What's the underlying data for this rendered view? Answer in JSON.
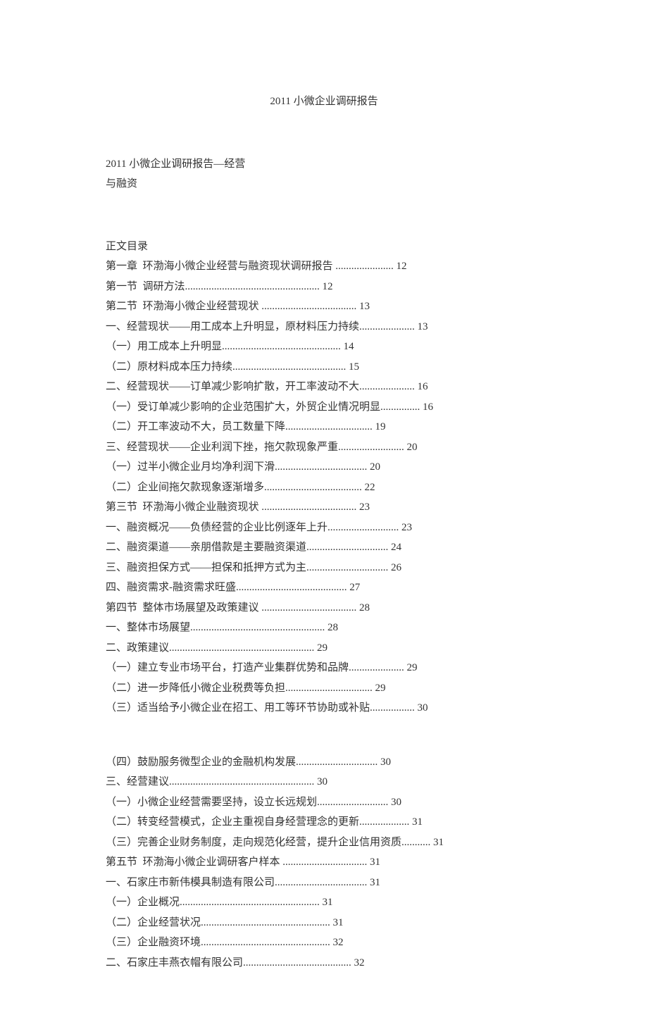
{
  "title": "2011 小微企业调研报告",
  "subtitle_line1": "2011 小微企业调研报告—经营",
  "subtitle_line2": "与融资",
  "toc_heading": "正文目录",
  "toc": [
    {
      "text": "第一章  环渤海小微企业经营与融资现状调研报告 ",
      "page": "12"
    },
    {
      "text": "第一节  调研方法",
      "page": "12"
    },
    {
      "text": "第二节  环渤海小微企业经营现状 ",
      "page": "13"
    },
    {
      "text": "一、经营现状——用工成本上升明显，原材料压力持续",
      "page": "13"
    },
    {
      "text": "（一）用工成本上升明显",
      "page": "14"
    },
    {
      "text": "（二）原材料成本压力持续",
      "page": "15"
    },
    {
      "text": "二、经营现状——订单减少影响扩散，开工率波动不大",
      "page": "16"
    },
    {
      "text": "（一）受订单减少影响的企业范围扩大，外贸企业情况明显",
      "page": "16"
    },
    {
      "text": "（二）开工率波动不大，员工数量下降",
      "page": "19"
    },
    {
      "text": "三、经营现状——企业利润下挫，拖欠款现象严重",
      "page": "20"
    },
    {
      "text": "（一）过半小微企业月均净利润下滑",
      "page": "20"
    },
    {
      "text": "（二）企业间拖欠款现象逐渐增多",
      "page": "22"
    },
    {
      "text": "第三节  环渤海小微企业融资现状 ",
      "page": "23"
    },
    {
      "text": "一、融资概况——负债经营的企业比例逐年上升",
      "page": "23"
    },
    {
      "text": "二、融资渠道——亲朋借款是主要融资渠道",
      "page": "24"
    },
    {
      "text": "三、融资担保方式——担保和抵押方式为主",
      "page": "26"
    },
    {
      "text": "四、融资需求-融资需求旺盛",
      "page": "27"
    },
    {
      "text": "第四节  整体市场展望及政策建议 ",
      "page": "28"
    },
    {
      "text": "一、整体市场展望",
      "page": "28"
    },
    {
      "text": "二、政策建议",
      "page": "29"
    },
    {
      "text": "（一）建立专业市场平台，打造产业集群优势和品牌",
      "page": "29"
    },
    {
      "text": "（二）进一步降低小微企业税费等负担",
      "page": "29"
    },
    {
      "text": "（三）适当给予小微企业在招工、用工等环节协助或补贴",
      "page": "30"
    }
  ],
  "toc2": [
    {
      "text": "（四）鼓励服务微型企业的金融机构发展",
      "page": "30"
    },
    {
      "text": "三、经营建议",
      "page": "30"
    },
    {
      "text": "（一）小微企业经营需要坚持，设立长远规划",
      "page": "30"
    },
    {
      "text": "（二）转变经营模式，企业主重视自身经营理念的更新",
      "page": "31"
    },
    {
      "text": "（三）完善企业财务制度，走向规范化经营，提升企业信用资质",
      "page": "31"
    },
    {
      "text": "第五节  环渤海小微企业调研客户样本 ",
      "page": "31"
    },
    {
      "text": "一、石家庄市新伟模具制造有限公司",
      "page": "31"
    },
    {
      "text": "（一）企业概况",
      "page": "31"
    },
    {
      "text": "（二）企业经营状况",
      "page": "31"
    },
    {
      "text": "（三）企业融资环境",
      "page": "32"
    },
    {
      "text": "二、石家庄丰燕衣帽有限公司",
      "page": "32"
    }
  ]
}
